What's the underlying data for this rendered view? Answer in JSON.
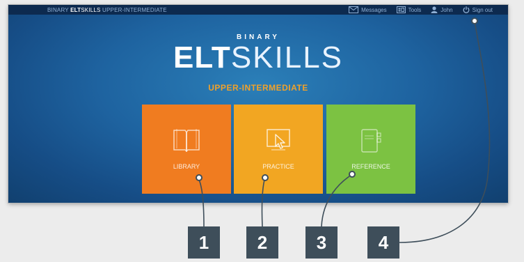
{
  "topbar": {
    "brand_prefix": "BINARY ",
    "brand_elt": "ELT",
    "brand_skills": "SKILLS",
    "brand_level": " UPPER-INTERMEDIATE",
    "nav": [
      {
        "label": "Messages",
        "icon": "envelope-icon"
      },
      {
        "label": "Tools",
        "icon": "tools-icon"
      },
      {
        "label": "John",
        "icon": "user-icon"
      },
      {
        "label": "Sign out",
        "icon": "power-icon"
      }
    ]
  },
  "logo": {
    "binary": "BINARY",
    "elt": "ELT",
    "skills": "SKILLS",
    "level": "UPPER-INTERMEDIATE"
  },
  "tiles": [
    {
      "label": "LIBRARY",
      "icon": "book-icon",
      "color": "#f07c20"
    },
    {
      "label": "PRACTICE",
      "icon": "cursor-screen-icon",
      "color": "#f2a622"
    },
    {
      "label": "REFERENCE",
      "icon": "notebook-icon",
      "color": "#7cc242"
    }
  ],
  "callouts": [
    "1",
    "2",
    "3",
    "4"
  ],
  "colors": {
    "callout_bg": "#3e4e5a",
    "accent_orange": "#f0a12a",
    "topbar": "#0d2a4f"
  }
}
